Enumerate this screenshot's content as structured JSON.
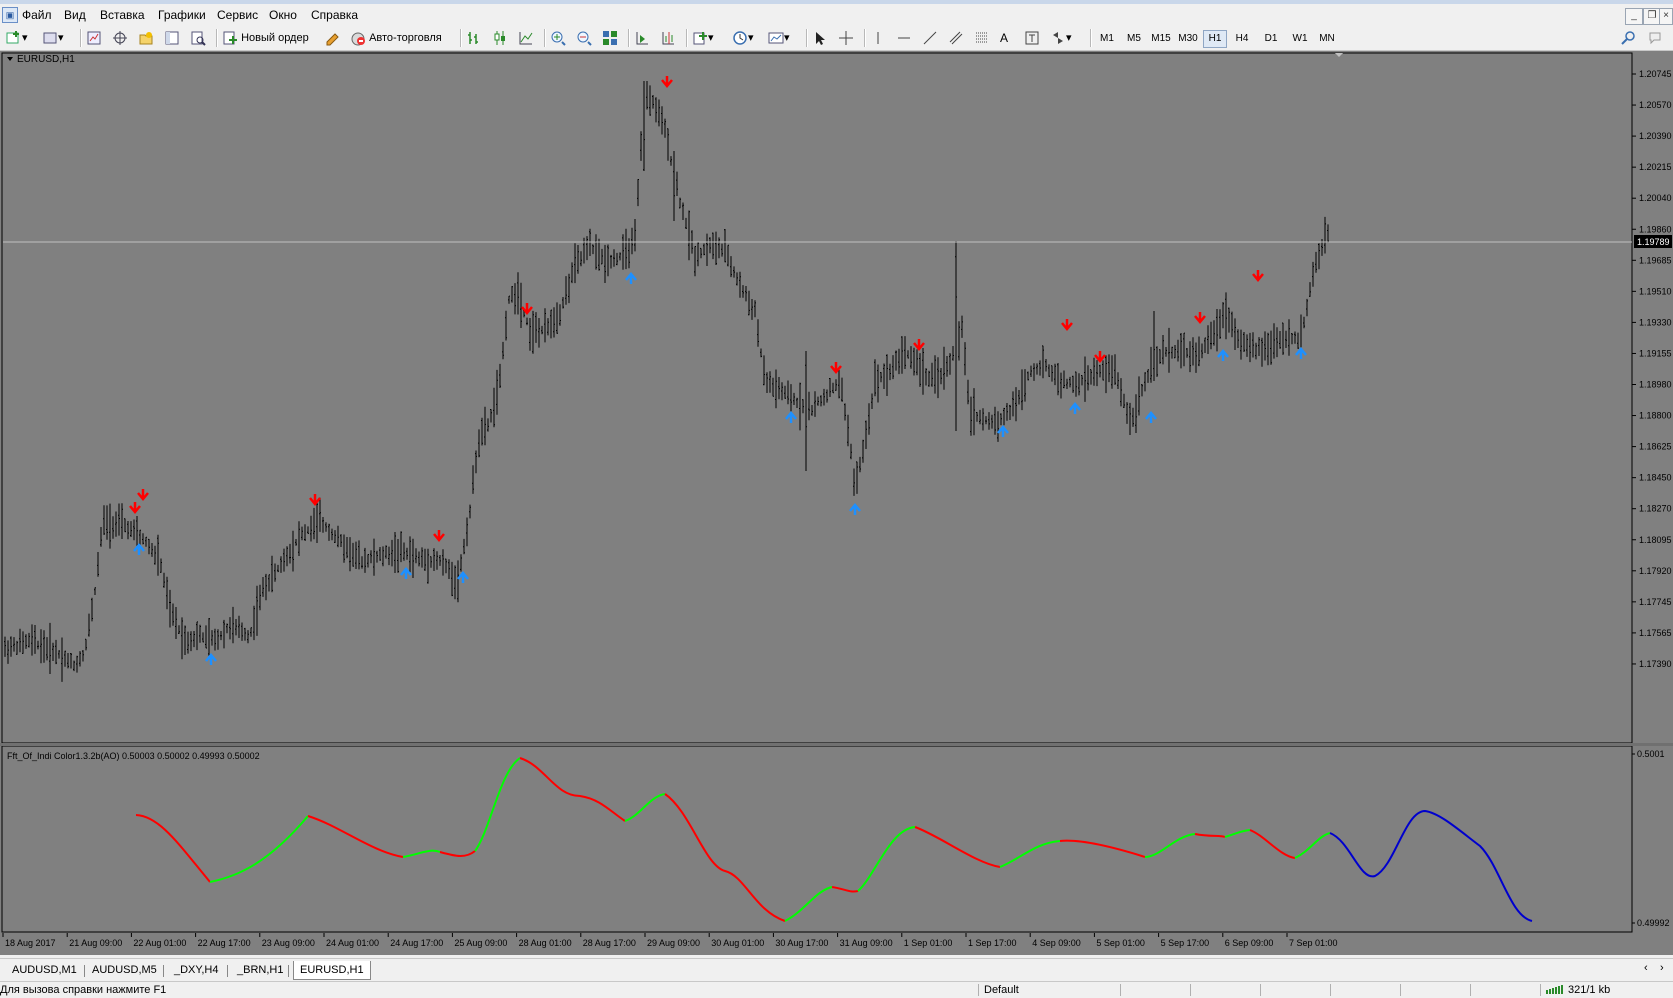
{
  "menu": {
    "items": [
      "Файл",
      "Вид",
      "Вставка",
      "Графики",
      "Сервис",
      "Окно",
      "Справка"
    ]
  },
  "toolbar": {
    "new_order_label": "Новый ордер",
    "autotrading_label": "Авто-торговля",
    "timeframes": [
      "M1",
      "M5",
      "M15",
      "M30",
      "H1",
      "H4",
      "D1",
      "W1",
      "MN"
    ],
    "active_timeframe": "H1"
  },
  "chart": {
    "symbol_label": "EURUSD,H1",
    "current_price": "1.19789",
    "price_ticks": [
      "1.20745",
      "1.20570",
      "1.20390",
      "1.20215",
      "1.20040",
      "1.19860",
      "1.19685",
      "1.19510",
      "1.19330",
      "1.19155",
      "1.18980",
      "1.18800",
      "1.18625",
      "1.18450",
      "1.18270",
      "1.18095",
      "1.17920",
      "1.17745",
      "1.17565",
      "1.17390"
    ],
    "time_ticks": [
      "18 Aug 2017",
      "21 Aug 09:00",
      "22 Aug 01:00",
      "22 Aug 17:00",
      "23 Aug 09:00",
      "24 Aug 01:00",
      "24 Aug 17:00",
      "25 Aug 09:00",
      "28 Aug 01:00",
      "28 Aug 17:00",
      "29 Aug 09:00",
      "30 Aug 01:00",
      "30 Aug 17:00",
      "31 Aug 09:00",
      "1 Sep 01:00",
      "1 Sep 17:00",
      "4 Sep 09:00",
      "5 Sep 01:00",
      "5 Sep 17:00",
      "6 Sep 09:00",
      "7 Sep 01:00"
    ],
    "colors": {
      "background": "#808080",
      "bars": "#000000",
      "down_arrow": "#ff0000",
      "up_arrow": "#1e90ff",
      "price_line": "#c0c0c0"
    }
  },
  "indicator": {
    "label": "Fft_Of_Indi Color1.3.2b(AO) 0.50003 0.50002 0.49993 0.50002",
    "scale_top": "0.5001",
    "scale_bottom": "0.49992",
    "colors": {
      "up": "#00ff00",
      "down": "#ff0000",
      "forecast": "#0000cd"
    }
  },
  "tabs": {
    "items": [
      "AUDUSD,M1",
      "AUDUSD,M5",
      "_DXY,H4",
      "_BRN,H1",
      "EURUSD,H1"
    ],
    "active": "EURUSD,H1"
  },
  "status": {
    "help_text": "Для вызова справки нажмите F1",
    "profile": "Default",
    "traffic": "321/1 kb"
  }
}
